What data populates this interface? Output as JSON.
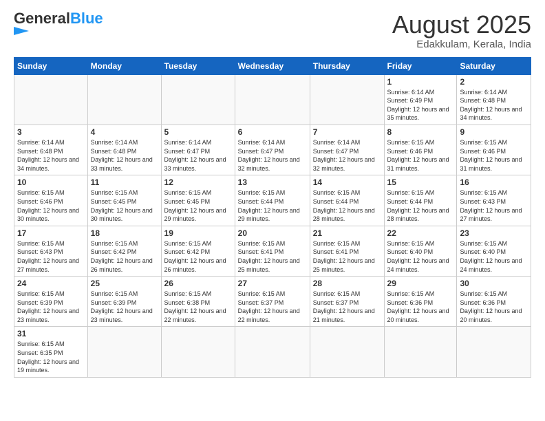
{
  "header": {
    "logo_general": "General",
    "logo_blue": "Blue",
    "month_title": "August 2025",
    "location": "Edakkulam, Kerala, India"
  },
  "days_of_week": [
    "Sunday",
    "Monday",
    "Tuesday",
    "Wednesday",
    "Thursday",
    "Friday",
    "Saturday"
  ],
  "weeks": [
    [
      {
        "day": "",
        "info": ""
      },
      {
        "day": "",
        "info": ""
      },
      {
        "day": "",
        "info": ""
      },
      {
        "day": "",
        "info": ""
      },
      {
        "day": "",
        "info": ""
      },
      {
        "day": "1",
        "info": "Sunrise: 6:14 AM\nSunset: 6:49 PM\nDaylight: 12 hours and 35 minutes."
      },
      {
        "day": "2",
        "info": "Sunrise: 6:14 AM\nSunset: 6:48 PM\nDaylight: 12 hours and 34 minutes."
      }
    ],
    [
      {
        "day": "3",
        "info": "Sunrise: 6:14 AM\nSunset: 6:48 PM\nDaylight: 12 hours and 34 minutes."
      },
      {
        "day": "4",
        "info": "Sunrise: 6:14 AM\nSunset: 6:48 PM\nDaylight: 12 hours and 33 minutes."
      },
      {
        "day": "5",
        "info": "Sunrise: 6:14 AM\nSunset: 6:47 PM\nDaylight: 12 hours and 33 minutes."
      },
      {
        "day": "6",
        "info": "Sunrise: 6:14 AM\nSunset: 6:47 PM\nDaylight: 12 hours and 32 minutes."
      },
      {
        "day": "7",
        "info": "Sunrise: 6:14 AM\nSunset: 6:47 PM\nDaylight: 12 hours and 32 minutes."
      },
      {
        "day": "8",
        "info": "Sunrise: 6:15 AM\nSunset: 6:46 PM\nDaylight: 12 hours and 31 minutes."
      },
      {
        "day": "9",
        "info": "Sunrise: 6:15 AM\nSunset: 6:46 PM\nDaylight: 12 hours and 31 minutes."
      }
    ],
    [
      {
        "day": "10",
        "info": "Sunrise: 6:15 AM\nSunset: 6:46 PM\nDaylight: 12 hours and 30 minutes."
      },
      {
        "day": "11",
        "info": "Sunrise: 6:15 AM\nSunset: 6:45 PM\nDaylight: 12 hours and 30 minutes."
      },
      {
        "day": "12",
        "info": "Sunrise: 6:15 AM\nSunset: 6:45 PM\nDaylight: 12 hours and 29 minutes."
      },
      {
        "day": "13",
        "info": "Sunrise: 6:15 AM\nSunset: 6:44 PM\nDaylight: 12 hours and 29 minutes."
      },
      {
        "day": "14",
        "info": "Sunrise: 6:15 AM\nSunset: 6:44 PM\nDaylight: 12 hours and 28 minutes."
      },
      {
        "day": "15",
        "info": "Sunrise: 6:15 AM\nSunset: 6:44 PM\nDaylight: 12 hours and 28 minutes."
      },
      {
        "day": "16",
        "info": "Sunrise: 6:15 AM\nSunset: 6:43 PM\nDaylight: 12 hours and 27 minutes."
      }
    ],
    [
      {
        "day": "17",
        "info": "Sunrise: 6:15 AM\nSunset: 6:43 PM\nDaylight: 12 hours and 27 minutes."
      },
      {
        "day": "18",
        "info": "Sunrise: 6:15 AM\nSunset: 6:42 PM\nDaylight: 12 hours and 26 minutes."
      },
      {
        "day": "19",
        "info": "Sunrise: 6:15 AM\nSunset: 6:42 PM\nDaylight: 12 hours and 26 minutes."
      },
      {
        "day": "20",
        "info": "Sunrise: 6:15 AM\nSunset: 6:41 PM\nDaylight: 12 hours and 25 minutes."
      },
      {
        "day": "21",
        "info": "Sunrise: 6:15 AM\nSunset: 6:41 PM\nDaylight: 12 hours and 25 minutes."
      },
      {
        "day": "22",
        "info": "Sunrise: 6:15 AM\nSunset: 6:40 PM\nDaylight: 12 hours and 24 minutes."
      },
      {
        "day": "23",
        "info": "Sunrise: 6:15 AM\nSunset: 6:40 PM\nDaylight: 12 hours and 24 minutes."
      }
    ],
    [
      {
        "day": "24",
        "info": "Sunrise: 6:15 AM\nSunset: 6:39 PM\nDaylight: 12 hours and 23 minutes."
      },
      {
        "day": "25",
        "info": "Sunrise: 6:15 AM\nSunset: 6:39 PM\nDaylight: 12 hours and 23 minutes."
      },
      {
        "day": "26",
        "info": "Sunrise: 6:15 AM\nSunset: 6:38 PM\nDaylight: 12 hours and 22 minutes."
      },
      {
        "day": "27",
        "info": "Sunrise: 6:15 AM\nSunset: 6:37 PM\nDaylight: 12 hours and 22 minutes."
      },
      {
        "day": "28",
        "info": "Sunrise: 6:15 AM\nSunset: 6:37 PM\nDaylight: 12 hours and 21 minutes."
      },
      {
        "day": "29",
        "info": "Sunrise: 6:15 AM\nSunset: 6:36 PM\nDaylight: 12 hours and 20 minutes."
      },
      {
        "day": "30",
        "info": "Sunrise: 6:15 AM\nSunset: 6:36 PM\nDaylight: 12 hours and 20 minutes."
      }
    ],
    [
      {
        "day": "31",
        "info": "Sunrise: 6:15 AM\nSunset: 6:35 PM\nDaylight: 12 hours and 19 minutes."
      },
      {
        "day": "",
        "info": ""
      },
      {
        "day": "",
        "info": ""
      },
      {
        "day": "",
        "info": ""
      },
      {
        "day": "",
        "info": ""
      },
      {
        "day": "",
        "info": ""
      },
      {
        "day": "",
        "info": ""
      }
    ]
  ]
}
